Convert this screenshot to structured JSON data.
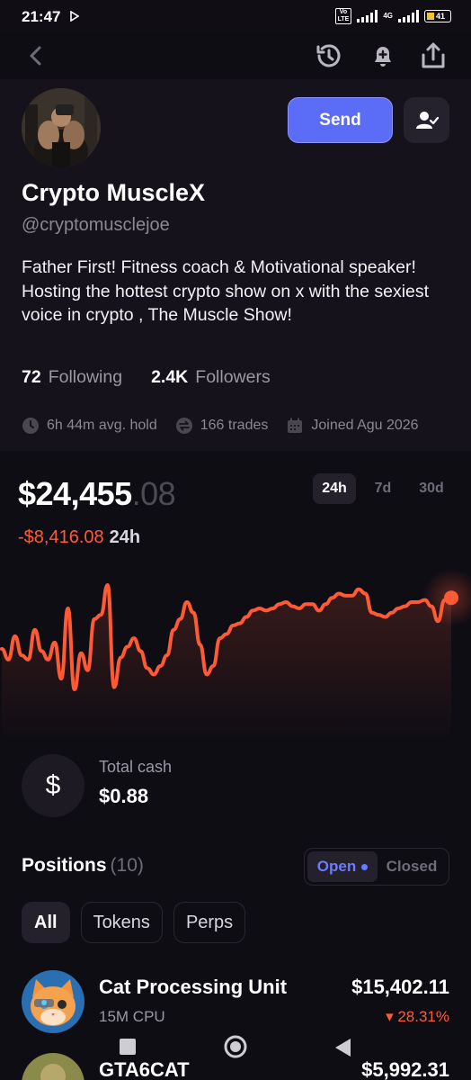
{
  "status": {
    "time": "21:47",
    "volte_line1": "Vo",
    "volte_line2": "LTE",
    "net": "4G",
    "battery": "41"
  },
  "profile": {
    "name": "Crypto MuscleX",
    "handle": "@cryptomusclejoe",
    "bio": "Father First!  Fitness coach & Motivational speaker! Hosting the hottest crypto show on x with the sexiest voice in crypto , The Muscle Show!",
    "following_count": "72",
    "following_label": "Following",
    "followers_count": "2.4K",
    "followers_label": "Followers",
    "avg_hold": "6h 44m avg. hold",
    "trades": "166 trades",
    "joined": "Joined Agu 2026",
    "send_label": "Send"
  },
  "portfolio": {
    "balance_main": "$24,455",
    "balance_cents": ".08",
    "change_value": "-$8,416.08",
    "change_period": "24h",
    "ranges": [
      "24h",
      "7d",
      "30d"
    ],
    "active_range": "24h"
  },
  "chart_data": {
    "type": "line",
    "title": "",
    "series": [
      {
        "values": [
          24,
          19,
          30,
          21,
          19,
          33,
          23,
          19,
          27,
          10,
          43,
          5,
          22,
          14,
          38,
          40,
          54,
          6,
          20,
          25,
          29,
          23,
          15,
          12,
          16,
          21,
          33,
          38,
          46,
          41,
          26,
          12,
          16,
          29,
          31,
          35,
          36,
          39,
          42,
          43,
          42,
          43,
          45,
          46,
          44,
          43,
          45,
          45,
          42,
          45,
          48,
          50,
          49,
          49,
          52,
          50,
          41,
          40,
          39,
          41,
          43,
          44,
          46,
          46,
          47,
          44,
          37,
          47,
          48
        ]
      }
    ],
    "grid": false,
    "legend": "none",
    "accent": "#ff5a36"
  },
  "cash": {
    "label": "Total cash",
    "value": "$0.88"
  },
  "positions": {
    "title": "Positions",
    "count": "(10)",
    "open_label": "Open",
    "closed_label": "Closed",
    "filters": [
      "All",
      "Tokens",
      "Perps"
    ],
    "items": [
      {
        "name": "Cat Processing Unit",
        "sub": "15M CPU",
        "value": "$15,402.11",
        "change": "▾ 28.31%"
      },
      {
        "name": "GTA6CAT",
        "sub": "",
        "value": "$5,992.31",
        "change": ""
      }
    ]
  },
  "colors": {
    "accent": "#5b6cf6",
    "negative": "#ff5a36",
    "background": "#0f0d14"
  }
}
